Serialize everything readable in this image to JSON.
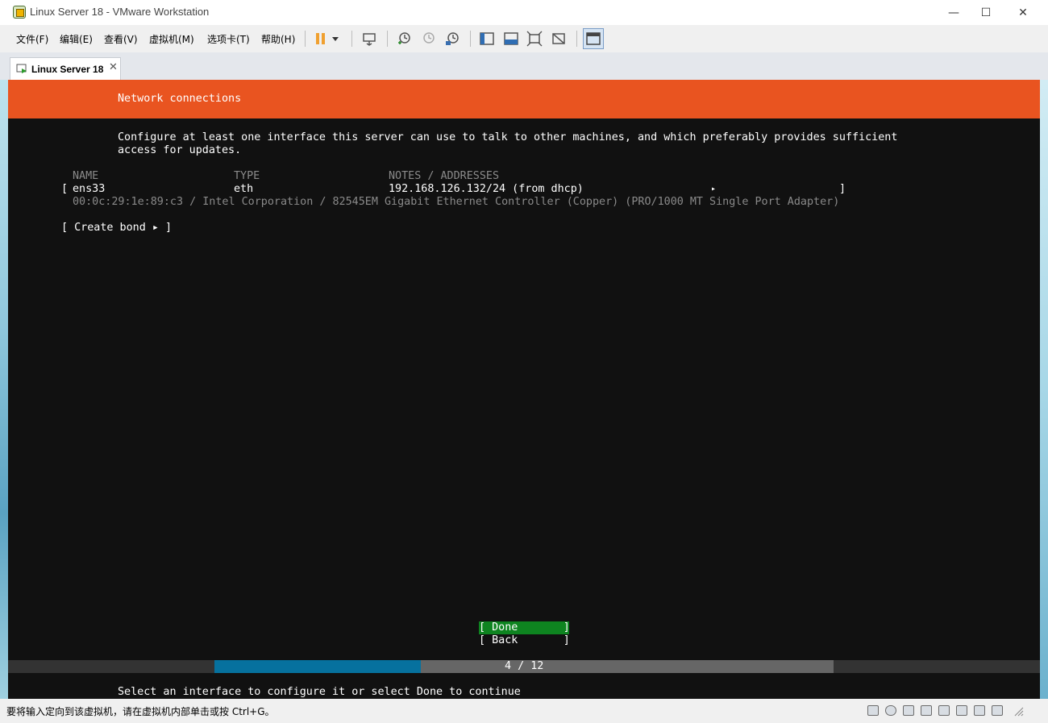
{
  "window": {
    "title": "Linux Server 18 - VMware Workstation",
    "controls": {
      "minimize": "—",
      "maximize": "☐",
      "close": "✕"
    }
  },
  "menu": [
    "文件(F)",
    "编辑(E)",
    "查看(V)",
    "虚拟机(M)",
    "选项卡(T)",
    "帮助(H)"
  ],
  "toolbar_icons": [
    "pause-icon",
    "dropdown-icon",
    "send-ctrl-alt-del-icon",
    "snapshot-icon",
    "revert-snapshot-icon",
    "snapshot-manager-icon",
    "library-icon",
    "thumbnail-icon",
    "full-screen-icon",
    "unity-icon",
    "console-view-icon"
  ],
  "tabs": [
    {
      "label": "Linux Server 18",
      "close": "✕"
    }
  ],
  "console": {
    "header": "Network connections",
    "description_line1": "Configure at least one interface this server can use to talk to other machines, and which preferably provides sufficient",
    "description_line2": "access for updates.",
    "table": {
      "headers": {
        "name": "NAME",
        "type": "TYPE",
        "notes": "NOTES / ADDRESSES"
      },
      "rows": [
        {
          "open": "[",
          "name": "ens33",
          "type": "eth",
          "notes": "192.168.126.132/24 (from dhcp)",
          "arrow": "▸",
          "close": "]",
          "detail": "00:0c:29:1e:89:c3 / Intel Corporation / 82545EM Gigabit Ethernet Controller (Copper) (PRO/1000 MT Single Port Adapter)"
        }
      ]
    },
    "create_bond": "[ Create bond ▸ ]",
    "done_button": "[ Done       ]",
    "back_button": "[ Back       ]",
    "progress": {
      "label": "4 / 12",
      "current": 4,
      "total": 12
    },
    "footer_hint": "Select an interface to configure it or select Done to continue"
  },
  "statusbar": {
    "message": "要将输入定向到该虚拟机，请在虚拟机内部单击或按 Ctrl+G。",
    "device_icons": [
      "hard-disk-icon",
      "cd-dvd-icon",
      "floppy-icon",
      "network-adapter-icon",
      "usb-icon",
      "sound-card-icon",
      "printer-icon",
      "display-icon"
    ]
  },
  "colors": {
    "ubuntu_orange": "#e95420",
    "done_green": "#0e8420",
    "progress_blue": "#06719e",
    "console_bg": "#111111"
  }
}
